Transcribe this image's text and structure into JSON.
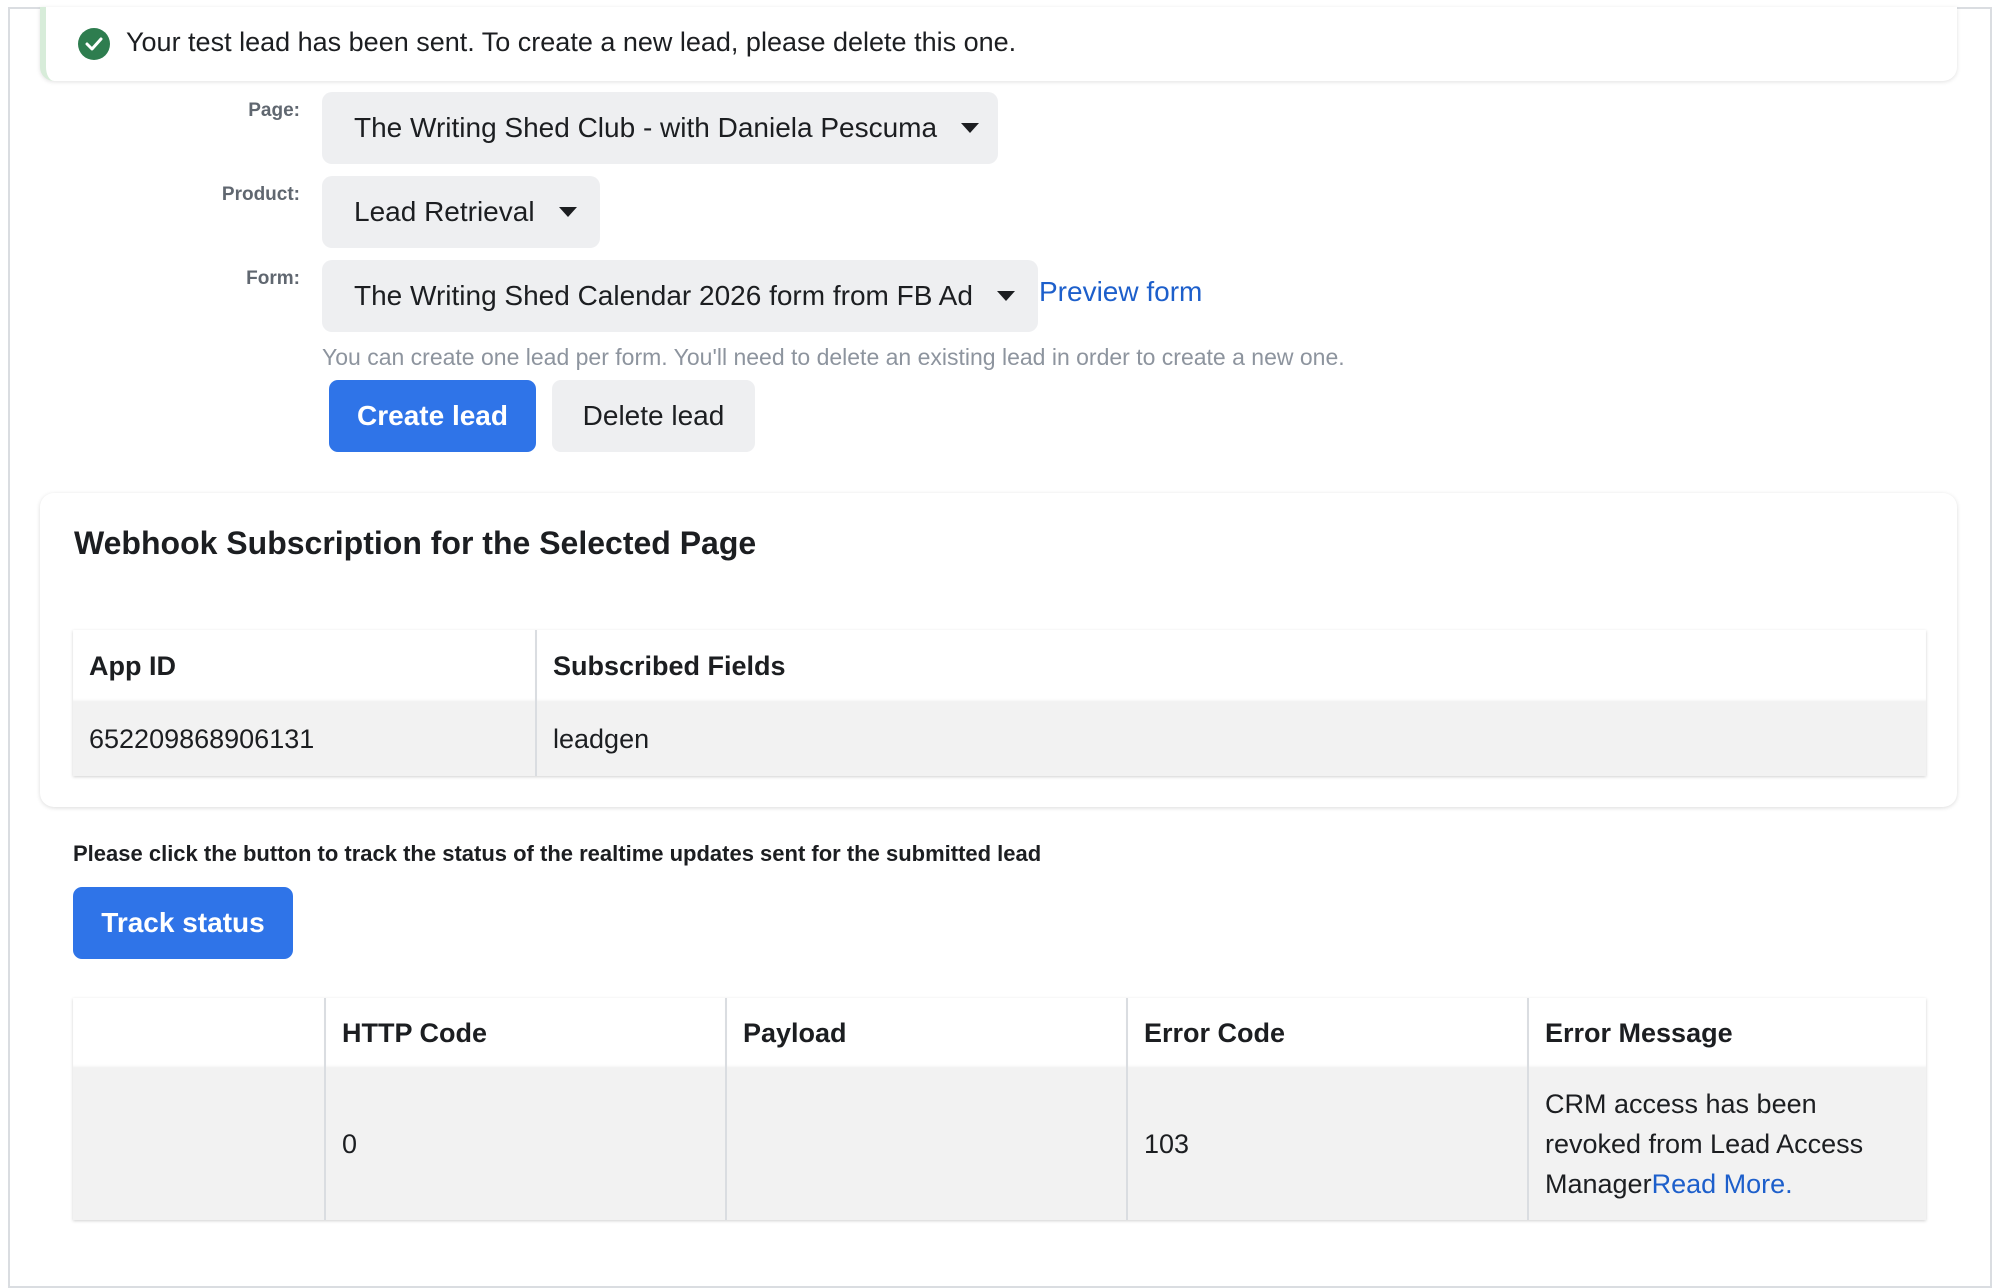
{
  "banner": {
    "message": "Your test lead has been sent. To create a new lead, please delete this one.",
    "status_color": "#2e7d4f"
  },
  "form": {
    "page_label": "Page:",
    "page_value": "The Writing Shed Club - with Daniela Pescuma",
    "product_label": "Product:",
    "product_value": "Lead Retrieval",
    "form_label": "Form:",
    "form_value": "The Writing Shed Calendar 2026 form from FB Ad",
    "preview_link": "Preview form",
    "hint": "You can create one lead per form. You'll need to delete an existing lead in order to create a new one.",
    "create_button": "Create lead",
    "delete_button": "Delete lead"
  },
  "webhook": {
    "title": "Webhook Subscription for the Selected Page",
    "columns": [
      "App ID",
      "Subscribed Fields"
    ],
    "rows": [
      [
        "652209868906131",
        "leadgen"
      ]
    ]
  },
  "tracking": {
    "prompt": "Please click the button to track the status of the realtime updates sent for the submitted lead",
    "button": "Track status",
    "columns": [
      "",
      "HTTP Code",
      "Payload",
      "Error Code",
      "Error Message"
    ],
    "rows": [
      {
        "first": "",
        "http_code": "0",
        "payload": "",
        "error_code": "103",
        "error_message": "CRM access has been revoked from Lead Access Manager",
        "read_more": "Read More."
      }
    ]
  },
  "colors": {
    "accent": "#2f74e8",
    "link": "#1d5fcb"
  }
}
